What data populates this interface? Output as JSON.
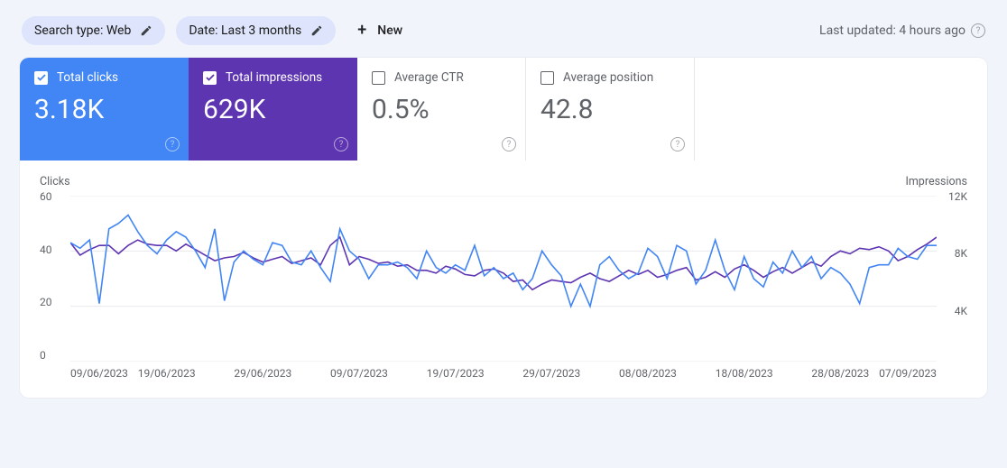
{
  "filters": {
    "search_type": "Search type: Web",
    "date_range": "Date: Last 3 months",
    "new_label": "New"
  },
  "updated_text": "Last updated: 4 hours ago",
  "cards": {
    "clicks": {
      "label": "Total clicks",
      "value": "3.18K"
    },
    "impressions": {
      "label": "Total impressions",
      "value": "629K"
    },
    "ctr": {
      "label": "Average CTR",
      "value": "0.5%"
    },
    "position": {
      "label": "Average position",
      "value": "42.8"
    }
  },
  "chart_data": {
    "type": "line",
    "left_axis_title": "Clicks",
    "right_axis_title": "Impressions",
    "y_left": {
      "ticks": [
        0,
        20,
        40,
        60
      ],
      "lim": [
        0,
        60
      ]
    },
    "y_right": {
      "ticks": [
        "",
        "4K",
        "8K",
        "12K"
      ],
      "lim": [
        0,
        12000
      ]
    },
    "x_ticks": [
      "09/06/2023",
      "19/06/2023",
      "29/06/2023",
      "09/07/2023",
      "19/07/2023",
      "29/07/2023",
      "08/08/2023",
      "18/08/2023",
      "28/08/2023",
      "07/09/2023"
    ],
    "n_points": 91,
    "series": [
      {
        "name": "Clicks",
        "axis": "left",
        "color": "#4285f4",
        "values": [
          43,
          41,
          44,
          21,
          48,
          50,
          53,
          47,
          42,
          39,
          44,
          47,
          45,
          40,
          34,
          48,
          22,
          36,
          40,
          37,
          35,
          43,
          42,
          36,
          35,
          40,
          34,
          29,
          48,
          40,
          37,
          30,
          35,
          35,
          36,
          34,
          30,
          40,
          34,
          32,
          35,
          33,
          42,
          31,
          34,
          30,
          32,
          26,
          30,
          40,
          35,
          31,
          20,
          28,
          20,
          35,
          38,
          33,
          30,
          32,
          41,
          38,
          30,
          42,
          40,
          28,
          33,
          44,
          33,
          26,
          38,
          30,
          27,
          36,
          32,
          40,
          34,
          38,
          30,
          34,
          32,
          28,
          21,
          34,
          35,
          35,
          41,
          38,
          37,
          42,
          42
        ]
      },
      {
        "name": "Impressions",
        "axis": "right",
        "color": "#5e35b1",
        "values": [
          8600,
          7700,
          8100,
          8400,
          8400,
          7800,
          8400,
          8800,
          8500,
          8400,
          8400,
          8000,
          8500,
          8100,
          7700,
          7300,
          7500,
          7600,
          7900,
          7500,
          7200,
          7400,
          7600,
          7100,
          7300,
          7500,
          7000,
          8400,
          9000,
          7000,
          7600,
          7400,
          7100,
          7200,
          6900,
          7000,
          6600,
          6600,
          6400,
          6900,
          6700,
          6300,
          6200,
          6600,
          6700,
          6400,
          5800,
          5900,
          5200,
          5600,
          5900,
          5800,
          5700,
          6100,
          6400,
          6000,
          5800,
          6200,
          6600,
          6300,
          6600,
          6100,
          6300,
          6600,
          6800,
          5900,
          6100,
          6500,
          6100,
          6700,
          7000,
          6600,
          6100,
          6500,
          6800,
          6400,
          6800,
          7200,
          6900,
          7600,
          8000,
          7800,
          8200,
          8100,
          8300,
          8000,
          7300,
          7600,
          8100,
          8500,
          9000
        ]
      }
    ]
  }
}
